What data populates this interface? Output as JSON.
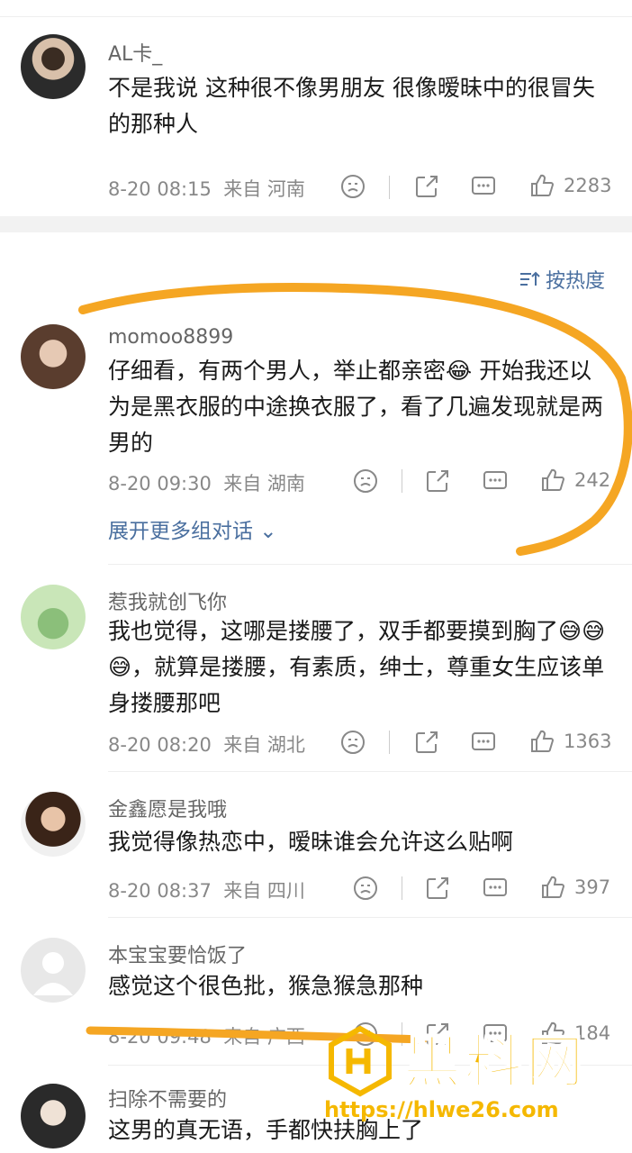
{
  "top_comment": {
    "user": "AL卡_",
    "text": "不是我说 这种很不像男朋友 很像暧昧中的很冒失的那种人",
    "time": "8-20 08:15",
    "from": "来自 河南",
    "likes": "2283"
  },
  "sort_label": "按热度",
  "comments": [
    {
      "user": "momoo8899",
      "text": "仔细看，有两个男人，举止都亲密😂 开始我还以为是黑衣服的中途换衣服了，看了几遍发现就是两男的",
      "time": "8-20 09:30",
      "from": "来自 湖南",
      "likes": "242",
      "expand": "展开更多组对话"
    },
    {
      "user": "惹我就创飞你",
      "text": "我也觉得，这哪是搂腰了，双手都要摸到胸了😅😅😅，就算是搂腰，有素质，绅士，尊重女生应该单身搂腰那吧",
      "time": "8-20 08:20",
      "from": "来自 湖北",
      "likes": "1363"
    },
    {
      "user": "金鑫愿是我哦",
      "text": "我觉得像热恋中，暧昧谁会允许这么贴啊",
      "time": "8-20 08:37",
      "from": "来自 四川",
      "likes": "397"
    },
    {
      "user": "本宝宝要恰饭了",
      "text": "感觉这个很色批，猴急猴急那种",
      "time": "8-20 09:48",
      "from": "来自 广西",
      "likes": "184"
    },
    {
      "user": "扫除不需要的",
      "text": "这男的真无语，手都快扶胸上了"
    }
  ],
  "watermark": {
    "brand": "黑料网",
    "url": "https://hlwe26.com"
  },
  "colors": {
    "link": "#4a6f9f",
    "annotation": "#f5a623",
    "watermark": "#f5b800"
  }
}
